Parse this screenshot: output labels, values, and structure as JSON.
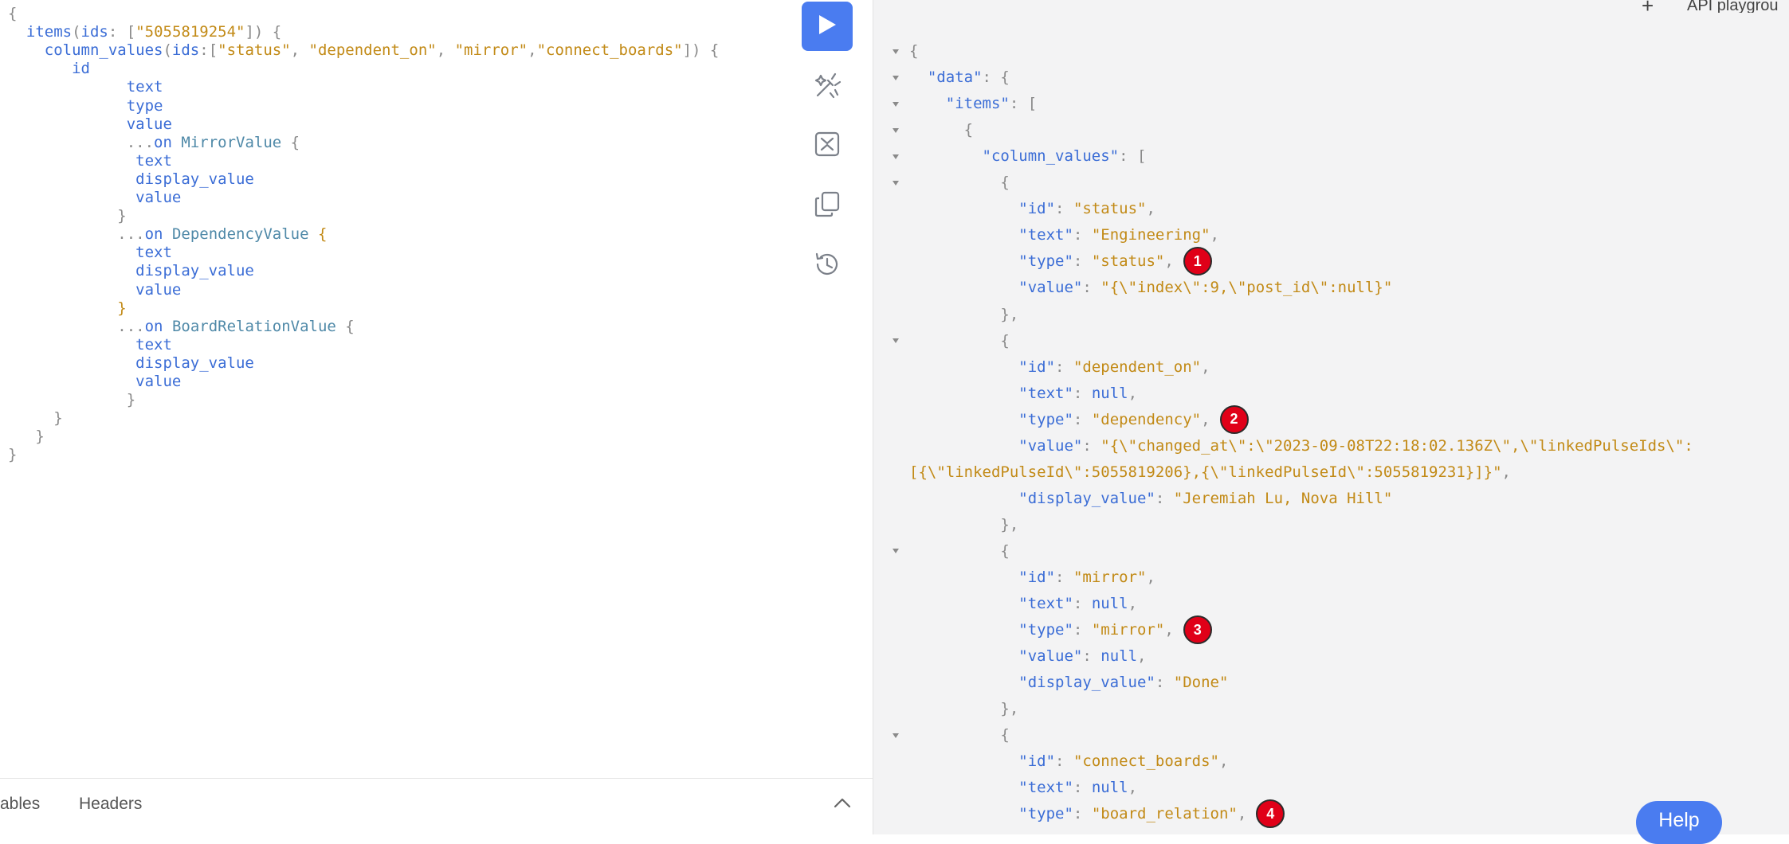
{
  "editor": {
    "lines": [
      {
        "parts": [
          {
            "c": "punc",
            "t": "{"
          }
        ]
      },
      {
        "parts": [
          {
            "c": "fld",
            "t": "  items"
          },
          {
            "c": "punc",
            "t": "("
          },
          {
            "c": "arg",
            "t": "ids"
          },
          {
            "c": "punc",
            "t": ": ["
          },
          {
            "c": "str",
            "t": "\"5055819254\""
          },
          {
            "c": "punc",
            "t": "]) {"
          }
        ]
      },
      {
        "parts": [
          {
            "c": "fld",
            "t": "    column_values"
          },
          {
            "c": "punc",
            "t": "("
          },
          {
            "c": "arg",
            "t": "ids"
          },
          {
            "c": "punc",
            "t": ":["
          },
          {
            "c": "str",
            "t": "\"status\""
          },
          {
            "c": "punc",
            "t": ", "
          },
          {
            "c": "str",
            "t": "\"dependent_on\""
          },
          {
            "c": "punc",
            "t": ", "
          },
          {
            "c": "str",
            "t": "\"mirror\""
          },
          {
            "c": "punc",
            "t": ","
          },
          {
            "c": "str",
            "t": "\"connect_boards\""
          },
          {
            "c": "punc",
            "t": "]) {"
          }
        ]
      },
      {
        "parts": [
          {
            "c": "fld",
            "t": "       id"
          }
        ]
      },
      {
        "parts": [
          {
            "c": "fld",
            "t": "             text"
          }
        ]
      },
      {
        "parts": [
          {
            "c": "fld",
            "t": "             type"
          }
        ]
      },
      {
        "parts": [
          {
            "c": "fld",
            "t": "             value"
          }
        ]
      },
      {
        "parts": [
          {
            "c": "punc",
            "t": "             ..."
          },
          {
            "c": "fld",
            "t": "on"
          },
          {
            "c": "punc",
            "t": " "
          },
          {
            "c": "type",
            "t": "MirrorValue"
          },
          {
            "c": "punc",
            "t": " {"
          }
        ]
      },
      {
        "parts": [
          {
            "c": "fld",
            "t": "              text"
          }
        ]
      },
      {
        "parts": [
          {
            "c": "fld",
            "t": "              display_value"
          }
        ]
      },
      {
        "parts": [
          {
            "c": "fld",
            "t": "              value"
          }
        ]
      },
      {
        "parts": [
          {
            "c": "punc",
            "t": "            }"
          }
        ]
      },
      {
        "parts": [
          {
            "c": "punc",
            "t": "            ..."
          },
          {
            "c": "fld",
            "t": "on"
          },
          {
            "c": "punc",
            "t": " "
          },
          {
            "c": "type",
            "t": "DependencyValue"
          },
          {
            "c": "punc",
            "t": " "
          },
          {
            "c": "brace-y",
            "t": "{"
          }
        ]
      },
      {
        "parts": [
          {
            "c": "fld",
            "t": "              text"
          }
        ]
      },
      {
        "parts": [
          {
            "c": "fld",
            "t": "              display_value"
          }
        ]
      },
      {
        "parts": [
          {
            "c": "fld",
            "t": "              value"
          }
        ]
      },
      {
        "parts": [
          {
            "c": "brace-y",
            "t": "            }"
          }
        ]
      },
      {
        "parts": [
          {
            "c": "punc",
            "t": "            ..."
          },
          {
            "c": "fld",
            "t": "on"
          },
          {
            "c": "punc",
            "t": " "
          },
          {
            "c": "type",
            "t": "BoardRelationValue"
          },
          {
            "c": "punc",
            "t": " {"
          }
        ]
      },
      {
        "parts": [
          {
            "c": "fld",
            "t": "              text"
          }
        ]
      },
      {
        "parts": [
          {
            "c": "fld",
            "t": "              display_value"
          }
        ]
      },
      {
        "parts": [
          {
            "c": "fld",
            "t": "              value"
          }
        ]
      },
      {
        "parts": [
          {
            "c": "punc",
            "t": "             }"
          }
        ]
      },
      {
        "parts": [
          {
            "c": "punc",
            "t": "     }"
          }
        ]
      },
      {
        "parts": [
          {
            "c": "punc",
            "t": "   }"
          }
        ]
      },
      {
        "parts": [
          {
            "c": "punc",
            "t": "}"
          }
        ]
      }
    ]
  },
  "toolbar": {
    "run_icon": "play-icon",
    "prettify_icon": "magic-wand-icon",
    "merge_icon": "merge-fragments-icon",
    "copy_icon": "copy-icon",
    "history_icon": "history-icon"
  },
  "bottom_tabs": {
    "variables": "ables",
    "headers": "Headers"
  },
  "top_right": {
    "add": "+",
    "label": "API playgrou"
  },
  "help": {
    "label": "Help"
  },
  "results": {
    "lines": [
      {
        "tri": true,
        "parts": [
          {
            "c": "punc",
            "t": "{"
          }
        ]
      },
      {
        "tri": true,
        "parts": [
          {
            "c": "punc",
            "t": "  "
          },
          {
            "c": "rkey",
            "t": "\"data\""
          },
          {
            "c": "punc",
            "t": ": {"
          }
        ]
      },
      {
        "tri": true,
        "parts": [
          {
            "c": "punc",
            "t": "    "
          },
          {
            "c": "rkey",
            "t": "\"items\""
          },
          {
            "c": "punc",
            "t": ": ["
          }
        ]
      },
      {
        "tri": true,
        "parts": [
          {
            "c": "punc",
            "t": "      {"
          }
        ]
      },
      {
        "tri": true,
        "parts": [
          {
            "c": "punc",
            "t": "        "
          },
          {
            "c": "rkey",
            "t": "\"column_values\""
          },
          {
            "c": "punc",
            "t": ": ["
          }
        ]
      },
      {
        "tri": true,
        "parts": [
          {
            "c": "punc",
            "t": "          {"
          }
        ]
      },
      {
        "tri": false,
        "parts": [
          {
            "c": "punc",
            "t": "            "
          },
          {
            "c": "rkey",
            "t": "\"id\""
          },
          {
            "c": "punc",
            "t": ": "
          },
          {
            "c": "rstr",
            "t": "\"status\""
          },
          {
            "c": "punc",
            "t": ","
          }
        ]
      },
      {
        "tri": false,
        "parts": [
          {
            "c": "punc",
            "t": "            "
          },
          {
            "c": "rkey",
            "t": "\"text\""
          },
          {
            "c": "punc",
            "t": ": "
          },
          {
            "c": "rstr",
            "t": "\"Engineering\""
          },
          {
            "c": "punc",
            "t": ","
          }
        ]
      },
      {
        "tri": false,
        "parts": [
          {
            "c": "punc",
            "t": "            "
          },
          {
            "c": "rkey",
            "t": "\"type\""
          },
          {
            "c": "punc",
            "t": ": "
          },
          {
            "c": "rstr",
            "t": "\"status\""
          },
          {
            "c": "punc",
            "t": ","
          }
        ]
      },
      {
        "tri": false,
        "parts": [
          {
            "c": "punc",
            "t": "            "
          },
          {
            "c": "rkey",
            "t": "\"value\""
          },
          {
            "c": "punc",
            "t": ": "
          },
          {
            "c": "rstr",
            "t": "\"{\\\"index\\\":9,\\\"post_id\\\":null}\""
          }
        ]
      },
      {
        "tri": false,
        "parts": [
          {
            "c": "punc",
            "t": "          },"
          }
        ]
      },
      {
        "tri": true,
        "parts": [
          {
            "c": "punc",
            "t": "          {"
          }
        ]
      },
      {
        "tri": false,
        "parts": [
          {
            "c": "punc",
            "t": "            "
          },
          {
            "c": "rkey",
            "t": "\"id\""
          },
          {
            "c": "punc",
            "t": ": "
          },
          {
            "c": "rstr",
            "t": "\"dependent_on\""
          },
          {
            "c": "punc",
            "t": ","
          }
        ]
      },
      {
        "tri": false,
        "parts": [
          {
            "c": "punc",
            "t": "            "
          },
          {
            "c": "rkey",
            "t": "\"text\""
          },
          {
            "c": "punc",
            "t": ": "
          },
          {
            "c": "rnull",
            "t": "null"
          },
          {
            "c": "punc",
            "t": ","
          }
        ]
      },
      {
        "tri": false,
        "parts": [
          {
            "c": "punc",
            "t": "            "
          },
          {
            "c": "rkey",
            "t": "\"type\""
          },
          {
            "c": "punc",
            "t": ": "
          },
          {
            "c": "rstr",
            "t": "\"dependency\""
          },
          {
            "c": "punc",
            "t": ","
          }
        ]
      },
      {
        "tri": false,
        "parts": [
          {
            "c": "punc",
            "t": "            "
          },
          {
            "c": "rkey",
            "t": "\"value\""
          },
          {
            "c": "punc",
            "t": ": "
          },
          {
            "c": "rstr",
            "t": "\"{\\\"changed_at\\\":\\\"2023-09-08T22:18:02.136Z\\\",\\\"linkedPulseIds\\\":"
          }
        ]
      },
      {
        "tri": false,
        "parts": [
          {
            "c": "rstr",
            "t": "[{\\\"linkedPulseId\\\":5055819206},{\\\"linkedPulseId\\\":5055819231}]}\""
          },
          {
            "c": "punc",
            "t": ","
          }
        ]
      },
      {
        "tri": false,
        "parts": [
          {
            "c": "punc",
            "t": "            "
          },
          {
            "c": "rkey",
            "t": "\"display_value\""
          },
          {
            "c": "punc",
            "t": ": "
          },
          {
            "c": "rstr",
            "t": "\"Jeremiah Lu, Nova Hill\""
          }
        ]
      },
      {
        "tri": false,
        "parts": [
          {
            "c": "punc",
            "t": "          },"
          }
        ]
      },
      {
        "tri": true,
        "parts": [
          {
            "c": "punc",
            "t": "          {"
          }
        ]
      },
      {
        "tri": false,
        "parts": [
          {
            "c": "punc",
            "t": "            "
          },
          {
            "c": "rkey",
            "t": "\"id\""
          },
          {
            "c": "punc",
            "t": ": "
          },
          {
            "c": "rstr",
            "t": "\"mirror\""
          },
          {
            "c": "punc",
            "t": ","
          }
        ]
      },
      {
        "tri": false,
        "parts": [
          {
            "c": "punc",
            "t": "            "
          },
          {
            "c": "rkey",
            "t": "\"text\""
          },
          {
            "c": "punc",
            "t": ": "
          },
          {
            "c": "rnull",
            "t": "null"
          },
          {
            "c": "punc",
            "t": ","
          }
        ]
      },
      {
        "tri": false,
        "parts": [
          {
            "c": "punc",
            "t": "            "
          },
          {
            "c": "rkey",
            "t": "\"type\""
          },
          {
            "c": "punc",
            "t": ": "
          },
          {
            "c": "rstr",
            "t": "\"mirror\""
          },
          {
            "c": "punc",
            "t": ","
          }
        ]
      },
      {
        "tri": false,
        "parts": [
          {
            "c": "punc",
            "t": "            "
          },
          {
            "c": "rkey",
            "t": "\"value\""
          },
          {
            "c": "punc",
            "t": ": "
          },
          {
            "c": "rnull",
            "t": "null"
          },
          {
            "c": "punc",
            "t": ","
          }
        ]
      },
      {
        "tri": false,
        "parts": [
          {
            "c": "punc",
            "t": "            "
          },
          {
            "c": "rkey",
            "t": "\"display_value\""
          },
          {
            "c": "punc",
            "t": ": "
          },
          {
            "c": "rstr",
            "t": "\"Done\""
          }
        ]
      },
      {
        "tri": false,
        "parts": [
          {
            "c": "punc",
            "t": "          },"
          }
        ]
      },
      {
        "tri": true,
        "parts": [
          {
            "c": "punc",
            "t": "          {"
          }
        ]
      },
      {
        "tri": false,
        "parts": [
          {
            "c": "punc",
            "t": "            "
          },
          {
            "c": "rkey",
            "t": "\"id\""
          },
          {
            "c": "punc",
            "t": ": "
          },
          {
            "c": "rstr",
            "t": "\"connect_boards\""
          },
          {
            "c": "punc",
            "t": ","
          }
        ]
      },
      {
        "tri": false,
        "parts": [
          {
            "c": "punc",
            "t": "            "
          },
          {
            "c": "rkey",
            "t": "\"text\""
          },
          {
            "c": "punc",
            "t": ": "
          },
          {
            "c": "rnull",
            "t": "null"
          },
          {
            "c": "punc",
            "t": ","
          }
        ]
      },
      {
        "tri": false,
        "parts": [
          {
            "c": "punc",
            "t": "            "
          },
          {
            "c": "rkey",
            "t": "\"type\""
          },
          {
            "c": "punc",
            "t": ": "
          },
          {
            "c": "rstr",
            "t": "\"board_relation\""
          },
          {
            "c": "punc",
            "t": ","
          }
        ]
      }
    ],
    "badges": [
      {
        "label": "1",
        "line": 8
      },
      {
        "label": "2",
        "line": 14
      },
      {
        "label": "3",
        "line": 22
      },
      {
        "label": "4",
        "line": 29
      }
    ]
  },
  "colors": {
    "accent": "#4a7cf0",
    "badge": "#e00018",
    "key": "#3b6dd6",
    "string": "#c28a16"
  }
}
